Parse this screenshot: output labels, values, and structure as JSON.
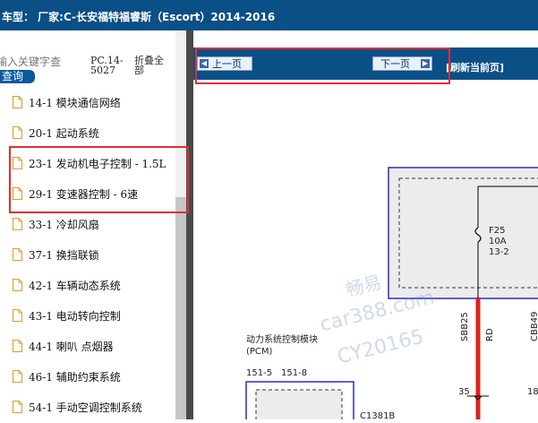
{
  "header": {
    "title": "车型：  厂家:C-长安福特福睿斯（Escort）2014-2016"
  },
  "sidebar": {
    "search_placeholder": "输入关键字查",
    "search_button": "查询",
    "pc_label": "PC.14-\n5027",
    "fold_all": "折叠全部",
    "items": [
      {
        "label": "14-1 模块通信网络"
      },
      {
        "label": "20-1 起动系统"
      },
      {
        "label": "23-1 发动机电子控制 - 1.5L"
      },
      {
        "label": "29-1 变速器控制 - 6速"
      },
      {
        "label": "33-1 冷却风扇"
      },
      {
        "label": "37-1 换挡联锁"
      },
      {
        "label": "42-1 车辆动态系统"
      },
      {
        "label": "43-1 电动转向控制"
      },
      {
        "label": "44-1 喇叭 点烟器"
      },
      {
        "label": "46-1 辅助约束系统"
      },
      {
        "label": "54-1 手动空调控制系统"
      }
    ]
  },
  "toolbar": {
    "prev_label": "上一页",
    "next_label": "下一页",
    "refresh_label": "[刷新当前页]"
  },
  "diagram": {
    "fuse_name": "F25",
    "fuse_rating": "10A",
    "fuse_loc": "13-2",
    "wire1_id": "SBB25",
    "wire1_color": "RD",
    "wire2_id": "CBB49",
    "module_name": "动力系统控制模块",
    "module_abbr": "(PCM)",
    "pin_a": "151-5",
    "pin_b": "151-8",
    "connector": "C1381B",
    "pin_35": "35",
    "pin_18": "18"
  },
  "watermark": {
    "line1": "畅易",
    "line2": "car388.com",
    "line3": "CY20165"
  },
  "colors": {
    "toolbar_bg": "#0a4f86",
    "highlight_border": "#e03030",
    "wire_red": "#e02020",
    "module_border": "#2a2acc"
  }
}
